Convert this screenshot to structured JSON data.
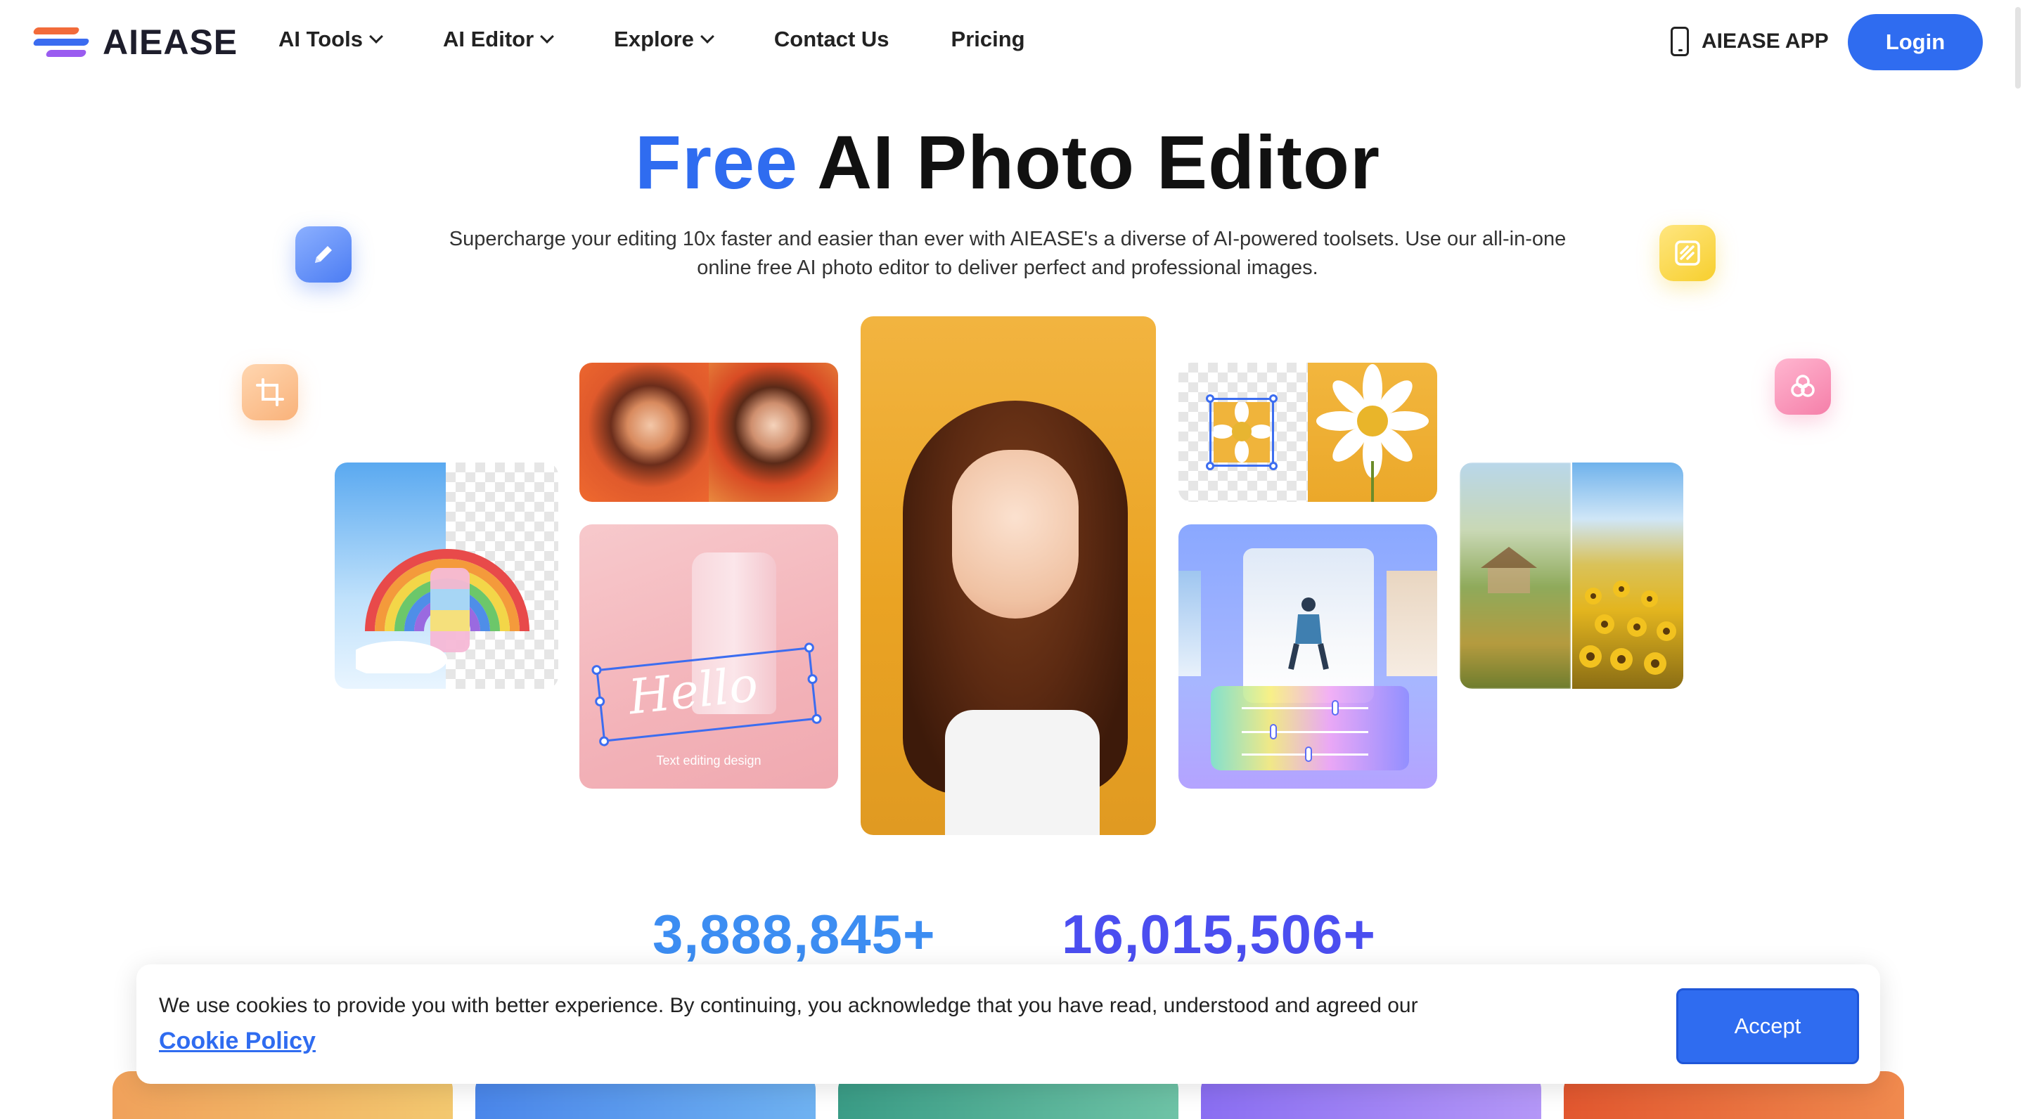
{
  "header": {
    "logo_text": "AIEASE",
    "nav": [
      {
        "label": "AI Tools",
        "has_dropdown": true
      },
      {
        "label": "AI Editor",
        "has_dropdown": true
      },
      {
        "label": "Explore",
        "has_dropdown": true
      },
      {
        "label": "Contact Us",
        "has_dropdown": false
      },
      {
        "label": "Pricing",
        "has_dropdown": false
      }
    ],
    "app_label": "AIEASE APP",
    "login_label": "Login"
  },
  "hero": {
    "title_accent": "Free",
    "title_rest": "AI Photo Editor",
    "subtitle": "Supercharge your editing 10x faster and easier than ever with AIEASE's a diverse of AI-powered toolsets. Use our all-in-one online free AI photo editor to deliver perfect and professional images.",
    "hello_text": "Hello",
    "hello_caption": "Text editing design"
  },
  "stats": {
    "stat_1": "3,888,845+",
    "stat_2": "16,015,506+"
  },
  "cookie": {
    "text": "We use cookies to provide you with better experience. By continuing, you acknowledge that you have read, understood and agreed our",
    "link_label": "Cookie Policy",
    "accept_label": "Accept"
  },
  "colors": {
    "brand_blue": "#2f6cf0",
    "stat_1": "#3c8df2",
    "stat_2": "#4b4ef0"
  },
  "icons": [
    "pencil-icon",
    "crop-icon",
    "edit-square-icon",
    "circles-icon",
    "phone-icon",
    "chevron-down-icon"
  ]
}
